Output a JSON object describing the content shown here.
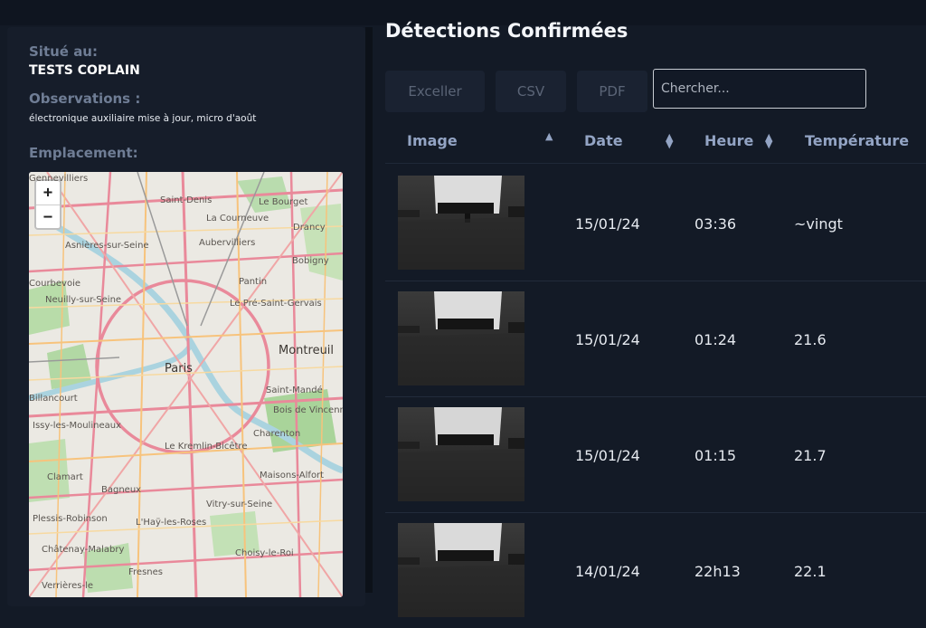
{
  "left": {
    "location_label": "Situé au:",
    "location_value": "TESTS COPLAIN",
    "observations_label": "Observations :",
    "observations_value": "électronique auxiliaire mise à jour, micro d'août",
    "emplacement_label": "Emplacement:"
  },
  "map": {
    "zoom_in": "+",
    "zoom_out": "−",
    "labels": {
      "gennevilliers": "Gennevilliers",
      "saint_denis": "Saint-Denis",
      "le_bourget": "Le Bourget",
      "la_courneuve": "La Courneuve",
      "drancy": "Drancy",
      "asnieres": "Asnières-sur-Seine",
      "aubervilliers": "Aubervilliers",
      "bobigny": "Bobigny",
      "courbevoie": "Courbevoie",
      "neuilly": "Neuilly-sur-Seine",
      "pantin": "Pantin",
      "pre_saint_gervais": "Le Pré-Saint-Gervais",
      "montreuil": "Montreuil",
      "paris": "Paris",
      "boulogne": "Billancourt",
      "saint_mande": "Saint-Mandé",
      "issy": "Issy-les-Moulineaux",
      "bois_vincennes": "Bois de Vincennes",
      "charenton": "Charenton",
      "le_kremlin": "Le Kremlin-Bicêtre",
      "clamart": "Clamart",
      "maisons_alfort": "Maisons-Alfort",
      "bagneux": "Bagneux",
      "vitry": "Vitry-sur-Seine",
      "plessis": "Plessis-Robinson",
      "hay": "L'Haÿ-les-Roses",
      "chatenay": "Châtenay-Malabry",
      "choisy": "Choisy-le-Roi",
      "fresnes": "Fresnes",
      "verrieres": "Verrières-le"
    }
  },
  "title": "Détections Confirmées",
  "toolbar": {
    "excel": "Exceller",
    "csv": "CSV",
    "pdf": "PDF",
    "search_placeholder": "Chercher..."
  },
  "table": {
    "headers": {
      "image": "Image",
      "date": "Date",
      "heure": "Heure",
      "temperature": "Température"
    },
    "rows": [
      {
        "date": "15/01/24",
        "heure": "03:36",
        "temperature": "~vingt"
      },
      {
        "date": "15/01/24",
        "heure": "01:24",
        "temperature": "21.6"
      },
      {
        "date": "15/01/24",
        "heure": "01:15",
        "temperature": "21.7"
      },
      {
        "date": "14/01/24",
        "heure": "22h13",
        "temperature": "22.1"
      }
    ]
  }
}
